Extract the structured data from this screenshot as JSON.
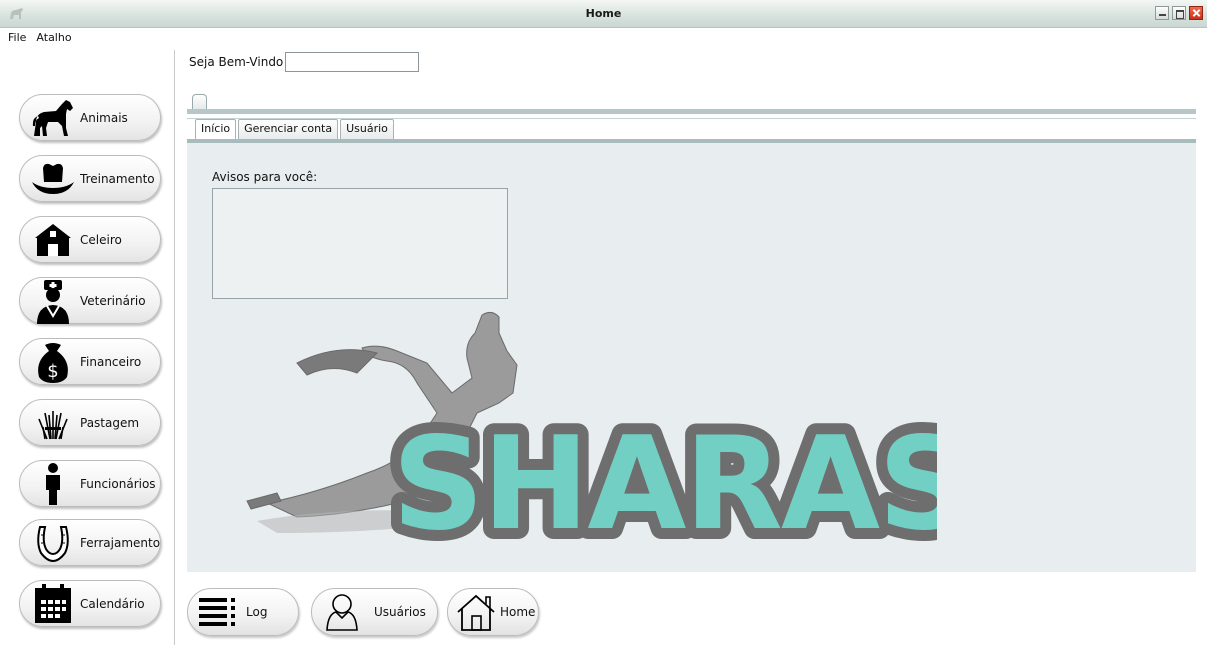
{
  "window": {
    "title": "Home"
  },
  "menu": {
    "items": [
      {
        "label": "File"
      },
      {
        "label": "Atalho"
      }
    ]
  },
  "welcome": {
    "label": "Seja Bem-Vindo",
    "value": ""
  },
  "sidebar": {
    "items": [
      {
        "label": "Animais",
        "icon": "horse-icon"
      },
      {
        "label": "Treinamento",
        "icon": "cowboy-hat-icon"
      },
      {
        "label": "Celeiro",
        "icon": "barn-icon"
      },
      {
        "label": "Veterinário",
        "icon": "veterinarian-icon"
      },
      {
        "label": "Financeiro",
        "icon": "money-bag-icon"
      },
      {
        "label": "Pastagem",
        "icon": "grass-icon"
      },
      {
        "label": "Funcionários",
        "icon": "person-icon"
      },
      {
        "label": "Ferrajamento",
        "icon": "horseshoe-icon"
      },
      {
        "label": "Calendário",
        "icon": "calendar-icon"
      }
    ]
  },
  "tabs": [
    {
      "label": "Início",
      "active": true
    },
    {
      "label": "Gerenciar conta",
      "active": false
    },
    {
      "label": "Usuário",
      "active": false
    }
  ],
  "notices": {
    "label": "Avisos para você:",
    "value": ""
  },
  "logo": {
    "text": "SHARAS",
    "fill_color": "#72cfc3",
    "outline_color": "#6b6b6b"
  },
  "bottom": {
    "items": [
      {
        "label": "Log",
        "icon": "list-icon"
      },
      {
        "label": "Usuários",
        "icon": "user-icon"
      },
      {
        "label": "Home",
        "icon": "house-icon"
      }
    ]
  }
}
